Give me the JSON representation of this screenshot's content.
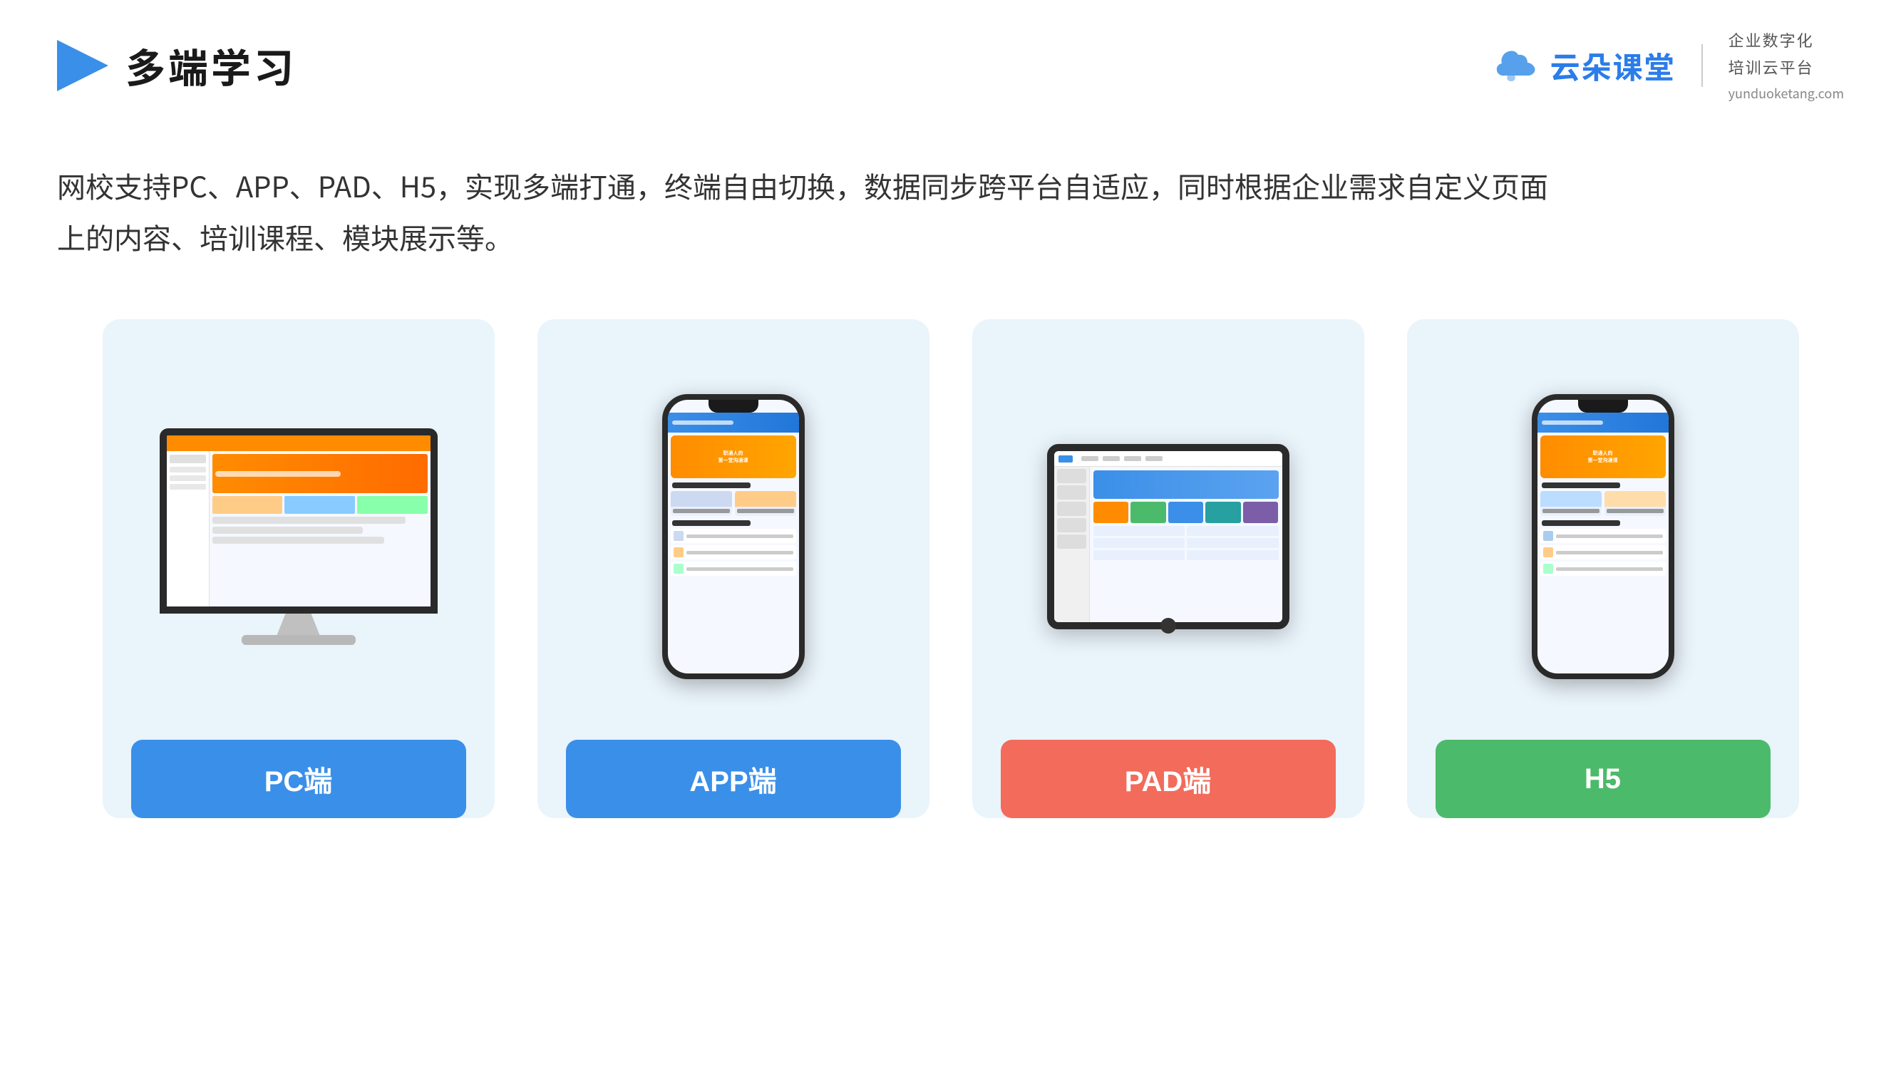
{
  "header": {
    "title": "多端学习",
    "brand_cn": "云朵课堂",
    "brand_url": "yunduoketang.com",
    "brand_slogan1": "企业数字化",
    "brand_slogan2": "培训云平台"
  },
  "description": {
    "line1": "网校支持PC、APP、PAD、H5，实现多端打通，终端自由切换，数据同步跨平台自适应，同时根据企业需求自定义页面",
    "line2": "上的内容、培训课程、模块展示等。"
  },
  "cards": [
    {
      "id": "pc",
      "label": "PC端",
      "button_color": "btn-blue",
      "type": "monitor"
    },
    {
      "id": "app",
      "label": "APP端",
      "button_color": "btn-blue2",
      "type": "phone"
    },
    {
      "id": "pad",
      "label": "PAD端",
      "button_color": "btn-red",
      "type": "tablet"
    },
    {
      "id": "h5",
      "label": "H5",
      "button_color": "btn-green",
      "type": "phone"
    }
  ],
  "colors": {
    "accent_blue": "#3a8fe8",
    "accent_red": "#f26b5b",
    "accent_green": "#4cba6b",
    "card_bg": "#eaf4fb",
    "text_dark": "#1a1a1a",
    "text_gray": "#555555"
  }
}
